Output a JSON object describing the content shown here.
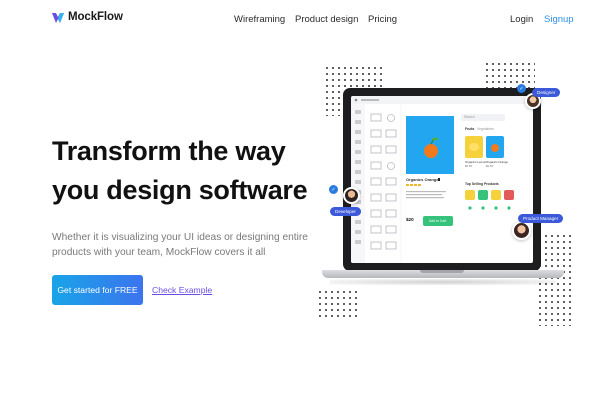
{
  "nav": {
    "brand": "MockFlow",
    "links": [
      "Wireframing",
      "Product design",
      "Pricing"
    ],
    "login": "Login",
    "signup": "Signup"
  },
  "hero": {
    "headline_line1": "Transform the way",
    "headline_line2": "you design software",
    "subtext_line1": "Whether it is visualizing your UI ideas or designing entire",
    "subtext_line2": "products with your team, MockFlow covers it all",
    "cta_label": "Get started for FREE",
    "secondary_label": "Check Example"
  },
  "illustration": {
    "tags": {
      "designer": "Designer",
      "developer": "Developer",
      "product_manager": "Product Manager"
    },
    "app": {
      "product_title": "Organics Orange",
      "price": "$20",
      "add_to_cart": "Add to Cart",
      "search_placeholder": "Search",
      "tab_fruits": "Fruits",
      "tab_vegetables": "Vegetables",
      "card1_title": "Organics Lemon",
      "card1_price": "$0.50",
      "card2_title": "Organics Orange",
      "card2_price": "$0.50",
      "top_selling": "Top Selling Products"
    }
  },
  "colors": {
    "accent_blue": "#2f8fe8",
    "cta_gradient_start": "#19a4e8",
    "cta_gradient_end": "#3c74ee",
    "link_purple": "#6b4de6",
    "app_green": "#35c27a",
    "tag_blue": "#3b59d8"
  },
  "icons": {
    "logo": "mockflow-logo-icon",
    "check": "check-icon",
    "dots": "dot-pattern"
  }
}
